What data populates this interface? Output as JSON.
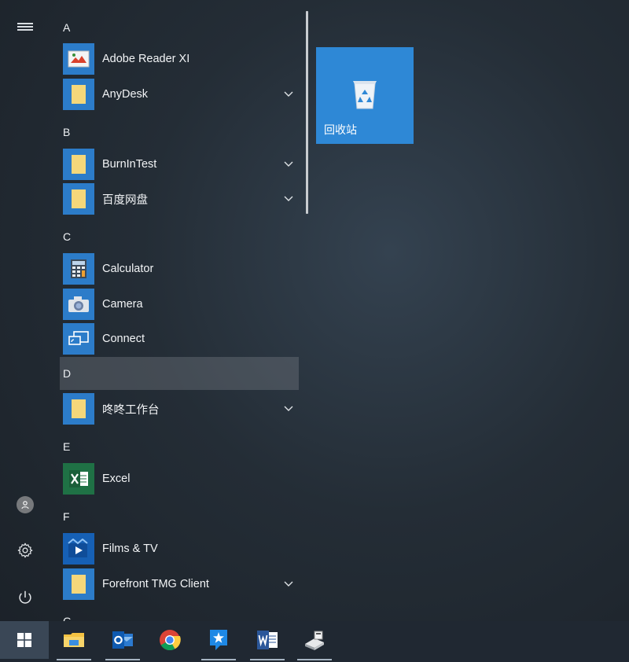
{
  "start_menu": {
    "letters": [
      "A",
      "B",
      "C",
      "D",
      "E",
      "F",
      "G"
    ],
    "apps": [
      {
        "label": "Adobe Reader XI"
      },
      {
        "label": "AnyDesk"
      },
      {
        "label": "BurnInTest"
      },
      {
        "label": "百度网盘"
      },
      {
        "label": "Calculator"
      },
      {
        "label": "Camera"
      },
      {
        "label": "Connect"
      },
      {
        "label": "咚咚工作台"
      },
      {
        "label": "Excel"
      },
      {
        "label": "Films & TV"
      },
      {
        "label": "Forefront TMG Client"
      }
    ]
  },
  "tiles": [
    {
      "label": "回收站",
      "icon": "recycle-bin-icon"
    }
  ],
  "left_rail": {
    "icons": [
      "hamburger-menu-icon",
      "user-icon",
      "settings-gear-icon",
      "power-icon"
    ]
  },
  "taskbar": {
    "items": [
      "start-button",
      "file-explorer-icon",
      "outlook-icon",
      "chrome-icon",
      "star-app-icon",
      "word-icon",
      "drive-install-icon"
    ]
  },
  "colors": {
    "tile_blue": "#2e88d6",
    "folder_icon_bg": "#2c7cc9",
    "folder_yellow": "#f5d77a",
    "highlight_row": "#6f757c"
  }
}
